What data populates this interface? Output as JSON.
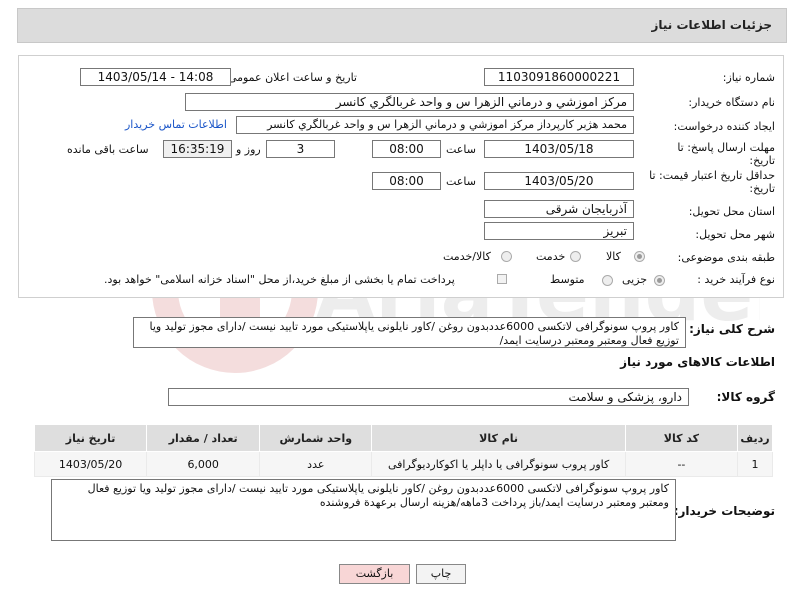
{
  "header": {
    "title": "جزئیات اطلاعات نیاز"
  },
  "fields": {
    "need_number": {
      "label": "شماره نیاز:",
      "value": "1103091860000221"
    },
    "announce_datetime": {
      "label": "تاریخ و ساعت اعلان عمومی:",
      "value": "1403/05/14 - 14:08"
    },
    "buyer_org": {
      "label": "نام دستگاه خریدار:",
      "value": "مرکز اموزشي و درماني الزهرا س  و واحد غربالگري کانسر"
    },
    "requester": {
      "label": "ایجاد کننده درخواست:",
      "value": "محمد هژبر کارپرداز مرکز اموزشي و درماني الزهرا س  و واحد غربالگري کانسر",
      "contact_link": "اطلاعات تماس خریدار"
    },
    "send_deadline": {
      "label": "مهلت ارسال پاسخ: تا تاریخ:",
      "date": "1403/05/18",
      "time_label": "ساعت",
      "time": "08:00",
      "days": "3",
      "days_label": "روز و",
      "remaining": "16:35:19",
      "remaining_label": "ساعت باقی مانده"
    },
    "price_validity": {
      "label": "حداقل تاریخ اعتبار قیمت: تا تاریخ:",
      "date": "1403/05/20",
      "time_label": "ساعت",
      "time": "08:00"
    },
    "province": {
      "label": "استان محل تحویل:",
      "value": "آذربایجان شرقی"
    },
    "city": {
      "label": "شهر محل تحویل:",
      "value": "تبریز"
    },
    "category": {
      "label": "طبقه بندی موضوعی:",
      "options": [
        "کالا",
        "خدمت",
        "کالا/خدمت"
      ],
      "selected": "کالا"
    },
    "purchase_type": {
      "label": "نوع فرآیند خرید :",
      "options": [
        "جزیی",
        "متوسط"
      ],
      "selected": "جزیی",
      "note": "پرداخت تمام یا بخشی از مبلغ خرید،از محل \"اسناد خزانه اسلامی\" خواهد بود."
    }
  },
  "summary": {
    "label": "شرح کلی نیاز:",
    "text": "کاور پروپ سونوگرافی لاتکسی 6000عددبدون روغن /کاور نایلونی یاپلاستیکی مورد تایید نیست /دارای مجوز تولید ویا توزیع فعال ومعتبر ومعتبر درسایت ایمد/"
  },
  "goods_section": {
    "title": "اطلاعات کالاهای مورد نیاز",
    "group_label": "گروه کالا:",
    "group_value": "دارو، پزشکی و سلامت"
  },
  "table": {
    "columns": [
      "ردیف",
      "کد کالا",
      "نام کالا",
      "واحد شمارش",
      "تعداد / مقدار",
      "تاریخ نیاز"
    ],
    "rows": [
      [
        "1",
        "--",
        "کاور پروب سونوگرافی یا داپلر یا اکوکاردیوگرافی",
        "عدد",
        "6,000",
        "1403/05/20"
      ]
    ]
  },
  "buyer_notes": {
    "label": "توضیحات خریدار:",
    "text": "کاور پروپ سونوگرافی لاتکسی 6000عددبدون روغن /کاور نایلونی یاپلاستیکی مورد تایید نیست /دارای مجوز تولید ویا توزیع فعال ومعتبر ومعتبر درسایت ایمد/باز پرداخت 3ماهه/هزینه ارسال برعهدة فروشنده"
  },
  "buttons": {
    "print": "چاپ",
    "back": "بازگشت"
  },
  "watermark": {
    "text": "AriaTender.net"
  },
  "colors": {
    "link": "#1a55c8",
    "back_button_bg": "#f8d6d6",
    "header_bg": "#dcdcdc"
  }
}
